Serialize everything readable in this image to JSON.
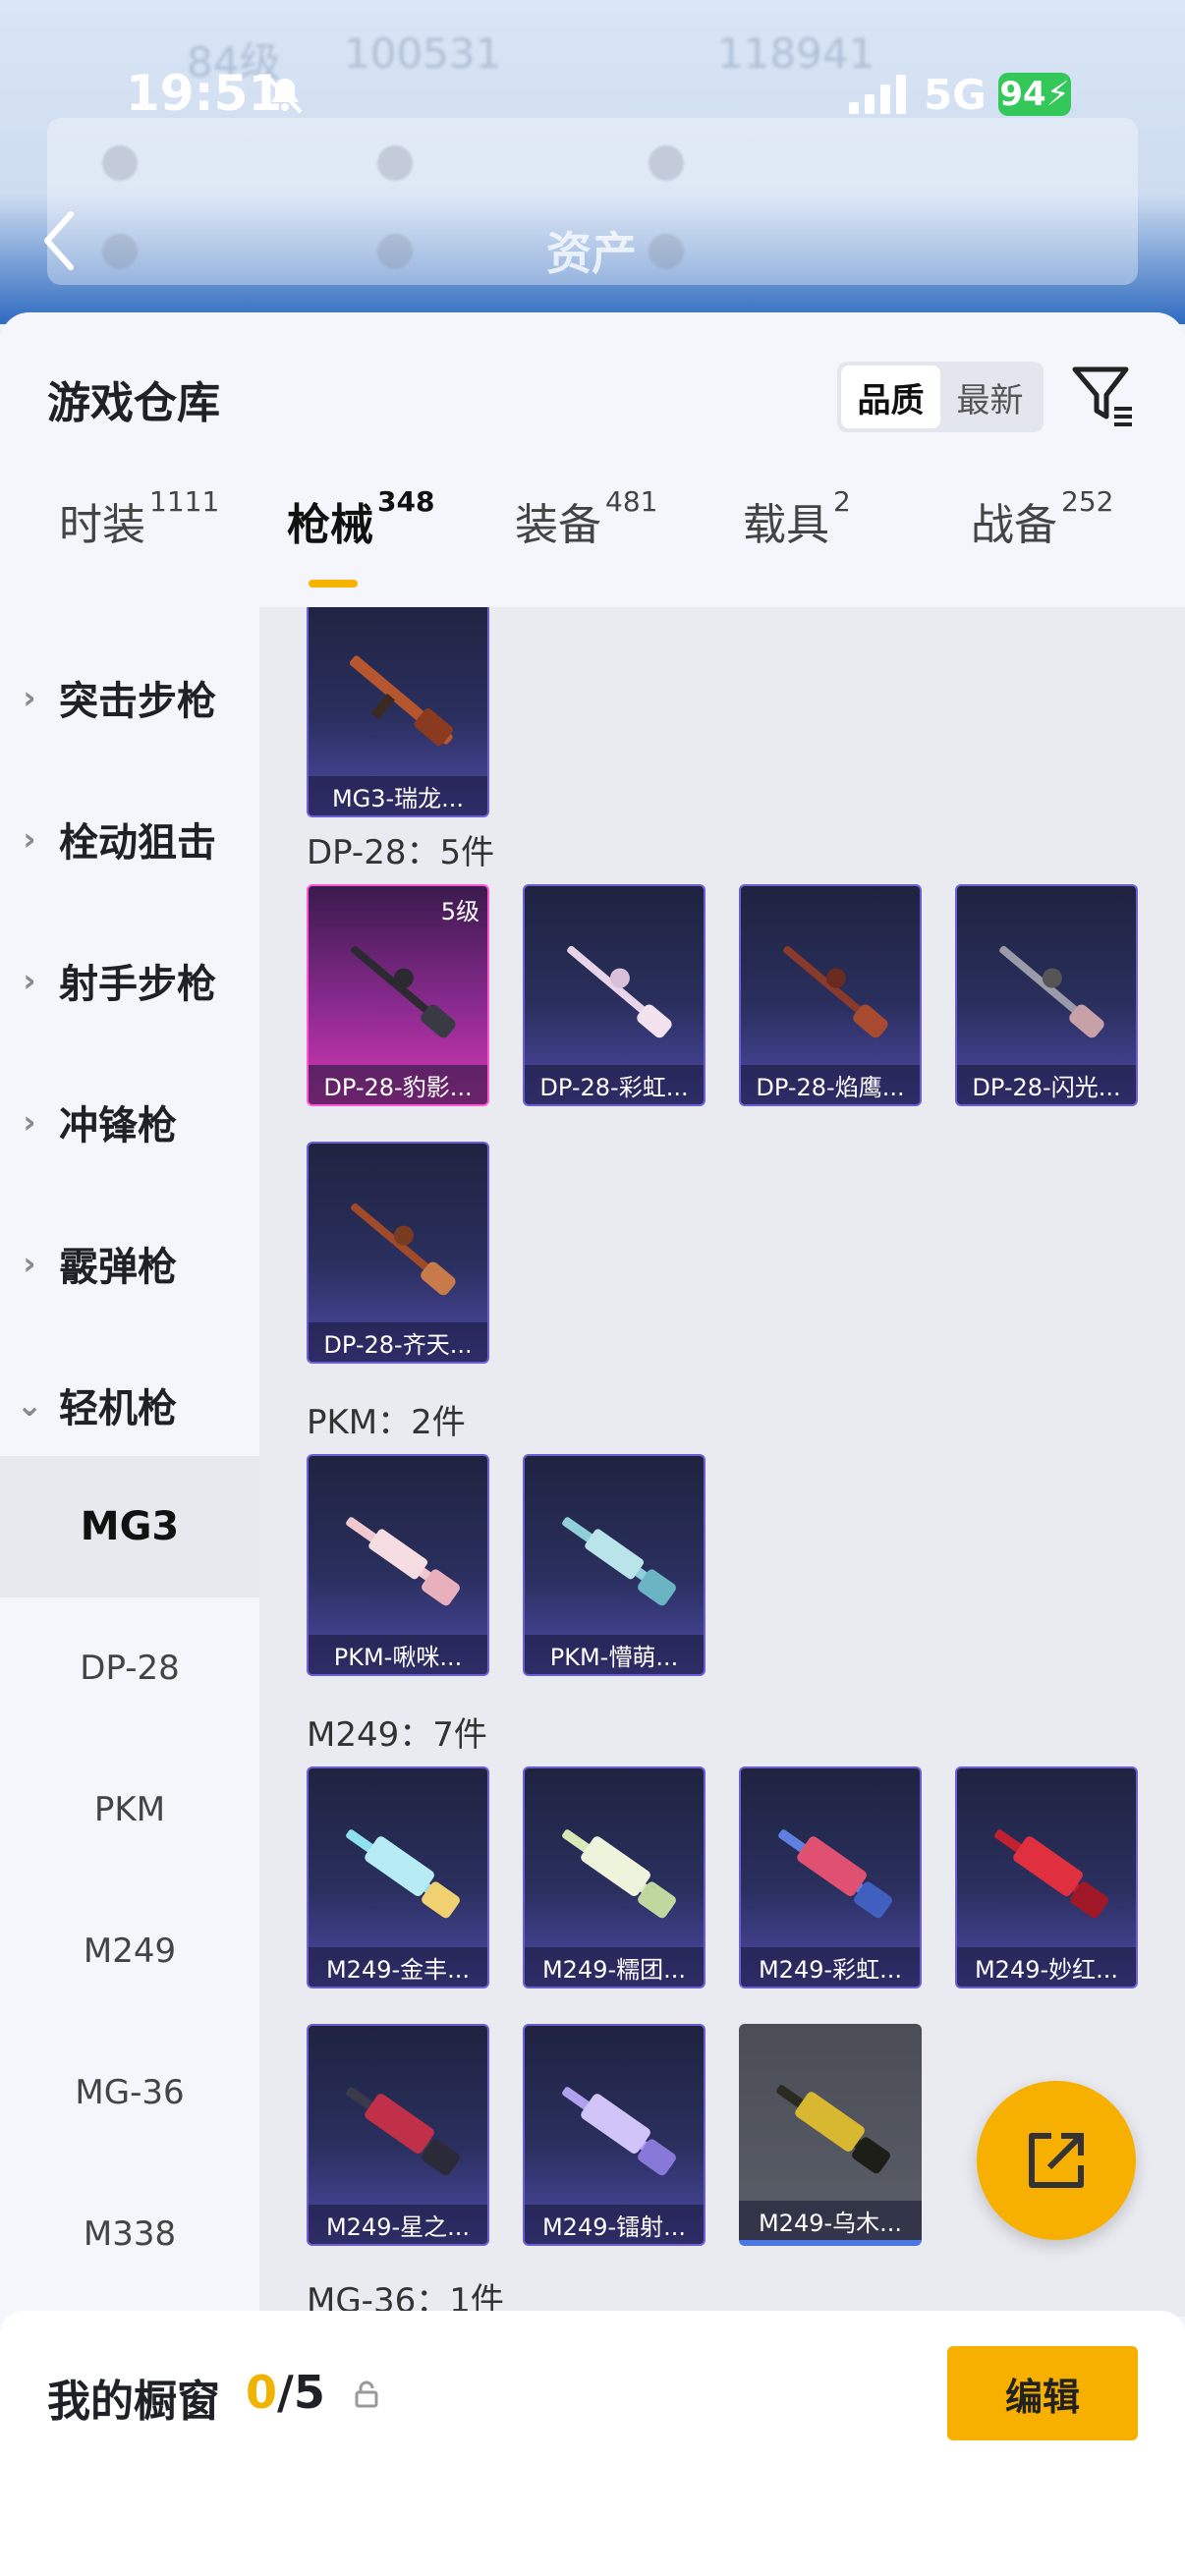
{
  "status_bar": {
    "time": "19:51",
    "network": "5G",
    "battery": "94"
  },
  "header": {
    "title": "资产"
  },
  "sheet": {
    "title": "游戏仓库",
    "sort": {
      "options": [
        "品质",
        "最新"
      ],
      "selected": "品质"
    }
  },
  "tabs": [
    {
      "label": "时装",
      "count": "1111"
    },
    {
      "label": "枪械",
      "count": "348",
      "active": true
    },
    {
      "label": "装备",
      "count": "481"
    },
    {
      "label": "载具",
      "count": "2"
    },
    {
      "label": "战备",
      "count": "252"
    }
  ],
  "sidebar": {
    "categories": [
      "突击步枪",
      "栓动狙击",
      "射手步枪",
      "冲锋枪",
      "霰弹枪",
      "轻机枪"
    ],
    "subcategories": [
      "MG3",
      "DP-28",
      "PKM",
      "M249",
      "MG-36",
      "M338"
    ],
    "active_subcategory": "MG3"
  },
  "groups": {
    "mg3": {
      "items": [
        {
          "name": "MG3-瑞龙..."
        }
      ]
    },
    "dp28": {
      "title": "DP-28：5件",
      "items": [
        {
          "name": "DP-28-豹影...",
          "level": "5级"
        },
        {
          "name": "DP-28-彩虹..."
        },
        {
          "name": "DP-28-焰鹰..."
        },
        {
          "name": "DP-28-闪光..."
        },
        {
          "name": "DP-28-齐天..."
        }
      ]
    },
    "pkm": {
      "title": "PKM：2件",
      "items": [
        {
          "name": "PKM-啾咪..."
        },
        {
          "name": "PKM-懵萌..."
        }
      ]
    },
    "m249": {
      "title": "M249：7件",
      "items": [
        {
          "name": "M249-金丰..."
        },
        {
          "name": "M249-糯团..."
        },
        {
          "name": "M249-彩虹..."
        },
        {
          "name": "M249-妙红..."
        },
        {
          "name": "M249-星之..."
        },
        {
          "name": "M249-镭射..."
        },
        {
          "name": "M249-乌木..."
        }
      ]
    },
    "mg36": {
      "title": "MG-36：1件"
    }
  },
  "showcase": {
    "label": "我的橱窗",
    "current": "0",
    "total": "/5",
    "edit_label": "编辑"
  },
  "colors": {
    "accent": "#f7b000",
    "card_purple": "#4f4aa8",
    "card_pink": "#d637b3"
  }
}
